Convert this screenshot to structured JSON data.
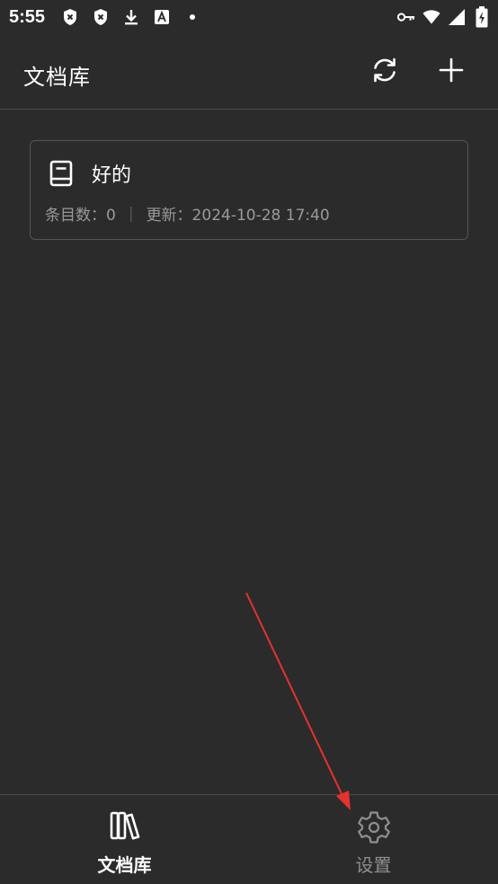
{
  "status_bar": {
    "time": "5:55",
    "left_icons": [
      "shield-x-icon",
      "shield-x-icon",
      "download-icon",
      "font-a-icon",
      "dot-icon"
    ],
    "right_icons": [
      "key-icon",
      "wifi-icon",
      "signal-icon",
      "battery-charging-icon"
    ]
  },
  "app_bar": {
    "title": "文档库",
    "actions": [
      "refresh-icon",
      "add-icon"
    ]
  },
  "library_list": [
    {
      "title": "好的",
      "count_label": "条目数：0",
      "updated_label": "更新：2024-10-28 17:40",
      "icon": "book-icon"
    }
  ],
  "bottom_nav": {
    "items": [
      {
        "label": "文档库",
        "icon": "library-books-icon",
        "active": true
      },
      {
        "label": "设置",
        "icon": "gear-icon",
        "active": false
      }
    ]
  },
  "colors": {
    "background": "#2b2b2b",
    "divider": "#4a4a4a",
    "text_primary": "#ffffff",
    "text_secondary": "#9a9a9a",
    "annotation_arrow": "#e5322d"
  }
}
